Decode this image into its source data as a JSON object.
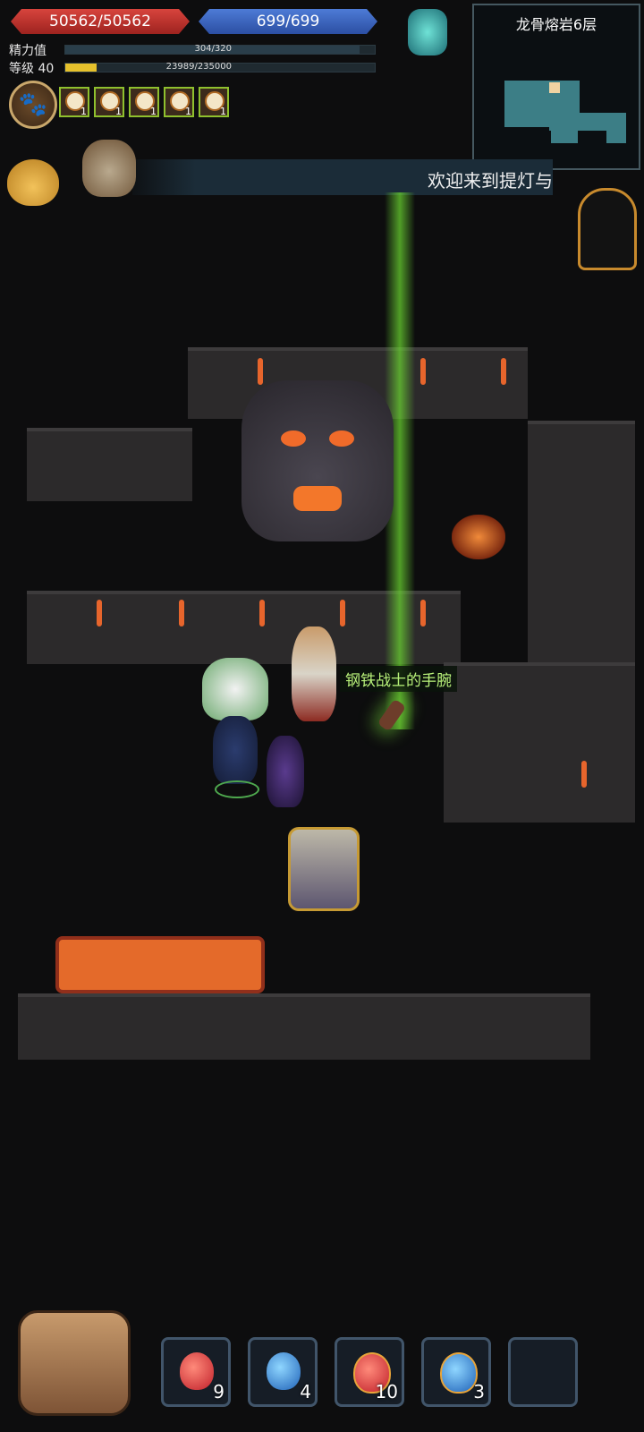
{
  "hud": {
    "hp": "50562/50562",
    "mp": "699/699",
    "energy_label": "精力值",
    "energy_value": "304/320",
    "energy_fraction": 0.95,
    "level_label": "等级 40",
    "exp_value": "23989/235000",
    "exp_fraction": 0.1,
    "buffs": [
      {
        "count": "1"
      },
      {
        "count": "1"
      },
      {
        "count": "1"
      },
      {
        "count": "1"
      },
      {
        "count": "1"
      }
    ]
  },
  "minimap": {
    "title": "龙骨熔岩6层"
  },
  "banner": {
    "text": "欢迎来到提灯与"
  },
  "world": {
    "item_label": "钢铁战士的手腕"
  },
  "hotbar": {
    "slots": [
      {
        "count": "9",
        "color": "#d23a3a"
      },
      {
        "count": "4",
        "color": "#3a8fd6"
      },
      {
        "count": "10",
        "color": "#d23a3a"
      },
      {
        "count": "3",
        "color": "#3a8fd6"
      },
      {
        "count": "",
        "color": ""
      }
    ]
  }
}
